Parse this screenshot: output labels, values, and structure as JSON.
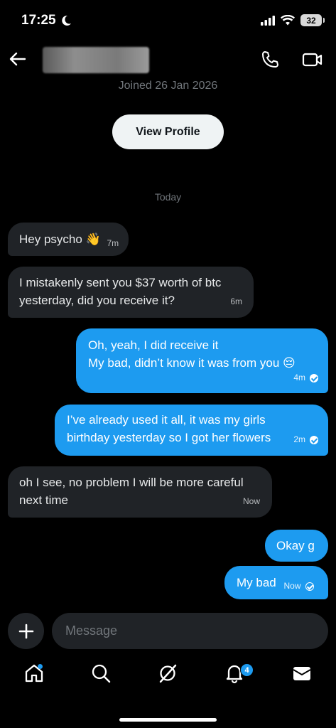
{
  "status_bar": {
    "time": "17:25",
    "battery": "32"
  },
  "header": {
    "joined": "Joined 26 Jan 2026",
    "view_profile": "View Profile"
  },
  "day_label": "Today",
  "messages": [
    {
      "dir": "in",
      "text": "Hey psycho 👋",
      "time": "7m"
    },
    {
      "dir": "in",
      "text_lines": [
        "I mistakenly sent you $37 worth of btc",
        "yesterday, did you receive it?"
      ],
      "time": "6m"
    },
    {
      "dir": "out",
      "text_lines": [
        "Oh, yeah, I did receive it",
        "My bad, didn’t know it was from you 😔"
      ],
      "time": "4m",
      "read": true
    },
    {
      "dir": "out",
      "text_lines": [
        "I’ve already used it all, it was my girls",
        "birthday yesterday so I got her flowers"
      ],
      "time": "2m",
      "read": true
    },
    {
      "dir": "in",
      "text_lines": [
        "oh I see, no problem I will be more careful",
        "next time"
      ],
      "time": "Now"
    },
    {
      "dir": "out",
      "text": "Okay g"
    },
    {
      "dir": "out",
      "text": "My bad",
      "time": "Now",
      "read": false
    }
  ],
  "composer": {
    "placeholder": "Message"
  },
  "nav": {
    "notifications_badge": "4"
  },
  "colors": {
    "accent": "#1d9bf0",
    "incoming_bubble": "#202327",
    "background": "#000000"
  }
}
